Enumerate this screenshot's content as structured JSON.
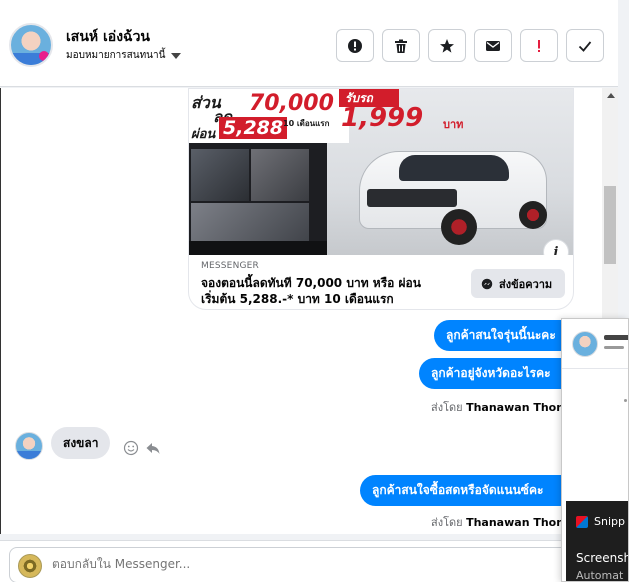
{
  "header": {
    "contact_name": "เสนห์ เอ่งฉ้วน",
    "assign_label": "มอบหมายการสนทนานี้"
  },
  "toolbar": {
    "buttons": [
      {
        "icon": "alert-circle-icon",
        "color": "#1c1e21"
      },
      {
        "icon": "trash-icon",
        "color": "#1c1e21"
      },
      {
        "icon": "star-icon",
        "color": "#1c1e21"
      },
      {
        "icon": "mail-icon",
        "color": "#1c1e21"
      },
      {
        "icon": "exclamation-icon",
        "color": "#e41e3f"
      },
      {
        "icon": "check-icon",
        "color": "#1c1e21"
      }
    ]
  },
  "ad_card": {
    "image_text": {
      "line1a": "ส่วน",
      "line1b": "ลด",
      "discount": "70,000",
      "line2": "ผ่อน",
      "installment": "5,288",
      "installment_sub": "10 เดือนแรก",
      "badge": "รับรถ",
      "price": "1,999",
      "baht": "บาท"
    },
    "source": "MESSENGER",
    "text": "จองตอนนี้ลดทันที 70,000 บาท หรือ ผ่อนเริ่มต้น 5,288.-* บาท 10 เดือนแรก",
    "send_button": "ส่งข้อความ",
    "info_label": "i"
  },
  "messages": {
    "out1": "ลูกค้าสนใจรุ่นนี้นะคะ",
    "out2": "ลูกค้าอยู่จังหวัดอะไรคะ",
    "sent_by_prefix": "ส่งโดย",
    "sent_by_name": "Thanawan Thon",
    "in1": "สงขลา",
    "out3": "ลูกค้าสนใจซื้อสดหรือจัดแนนซ์คะ"
  },
  "composer": {
    "placeholder": "ตอบกลับใน Messenger..."
  },
  "popup": {
    "snip_label": "Snipp",
    "title": "Screensh",
    "subtitle": "Automat"
  },
  "colors": {
    "outgoing_bubble": "#0084ff",
    "incoming_bubble": "#e4e6eb",
    "accent_red": "#d21d2b"
  }
}
